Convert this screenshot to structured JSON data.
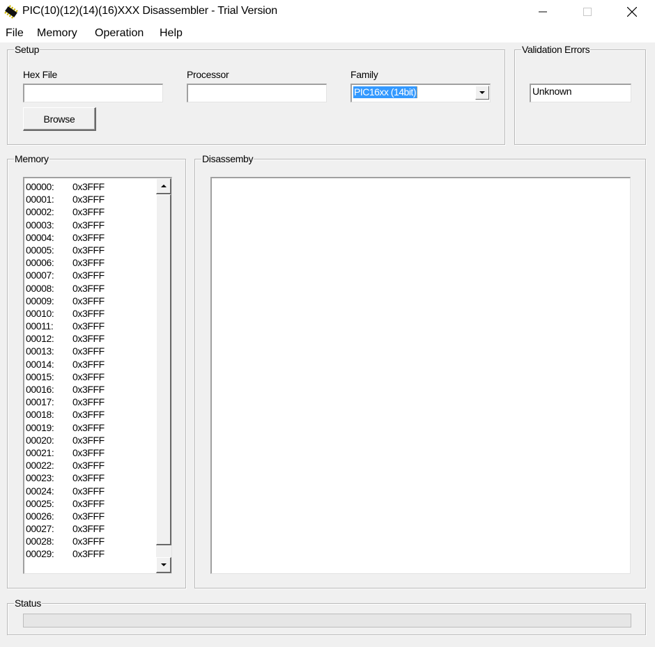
{
  "window": {
    "title": "PIC(10)(12)(14)(16)XXX Disassembler - Trial Version",
    "icon": "chip-icon",
    "controls": {
      "minimize": "minimize-icon",
      "maximize": "maximize-icon",
      "close": "close-icon"
    }
  },
  "menu": {
    "items": [
      {
        "label": "File"
      },
      {
        "label": "Memory"
      },
      {
        "label": "Operation"
      },
      {
        "label": "Help"
      }
    ]
  },
  "setup": {
    "group_label": "Setup",
    "hex_file": {
      "label": "Hex File",
      "value": ""
    },
    "processor": {
      "label": "Processor",
      "value": ""
    },
    "family": {
      "label": "Family",
      "selected": "PIC16xx (14bit)"
    },
    "browse_label": "Browse"
  },
  "validation": {
    "group_label": "Validation Errors",
    "value": "Unknown"
  },
  "memory": {
    "group_label": "Memory",
    "rows": [
      {
        "addr": "00000:",
        "value": "0x3FFF"
      },
      {
        "addr": "00001:",
        "value": "0x3FFF"
      },
      {
        "addr": "00002:",
        "value": "0x3FFF"
      },
      {
        "addr": "00003:",
        "value": "0x3FFF"
      },
      {
        "addr": "00004:",
        "value": "0x3FFF"
      },
      {
        "addr": "00005:",
        "value": "0x3FFF"
      },
      {
        "addr": "00006:",
        "value": "0x3FFF"
      },
      {
        "addr": "00007:",
        "value": "0x3FFF"
      },
      {
        "addr": "00008:",
        "value": "0x3FFF"
      },
      {
        "addr": "00009:",
        "value": "0x3FFF"
      },
      {
        "addr": "00010:",
        "value": "0x3FFF"
      },
      {
        "addr": "00011:",
        "value": "0x3FFF"
      },
      {
        "addr": "00012:",
        "value": "0x3FFF"
      },
      {
        "addr": "00013:",
        "value": "0x3FFF"
      },
      {
        "addr": "00014:",
        "value": "0x3FFF"
      },
      {
        "addr": "00015:",
        "value": "0x3FFF"
      },
      {
        "addr": "00016:",
        "value": "0x3FFF"
      },
      {
        "addr": "00017:",
        "value": "0x3FFF"
      },
      {
        "addr": "00018:",
        "value": "0x3FFF"
      },
      {
        "addr": "00019:",
        "value": "0x3FFF"
      },
      {
        "addr": "00020:",
        "value": "0x3FFF"
      },
      {
        "addr": "00021:",
        "value": "0x3FFF"
      },
      {
        "addr": "00022:",
        "value": "0x3FFF"
      },
      {
        "addr": "00023:",
        "value": "0x3FFF"
      },
      {
        "addr": "00024:",
        "value": "0x3FFF"
      },
      {
        "addr": "00025:",
        "value": "0x3FFF"
      },
      {
        "addr": "00026:",
        "value": "0x3FFF"
      },
      {
        "addr": "00027:",
        "value": "0x3FFF"
      },
      {
        "addr": "00028:",
        "value": "0x3FFF"
      },
      {
        "addr": "00029:",
        "value": "0x3FFF"
      }
    ]
  },
  "disassembly": {
    "group_label": "Disassemby",
    "content": ""
  },
  "status": {
    "group_label": "Status",
    "progress_percent": 0
  }
}
